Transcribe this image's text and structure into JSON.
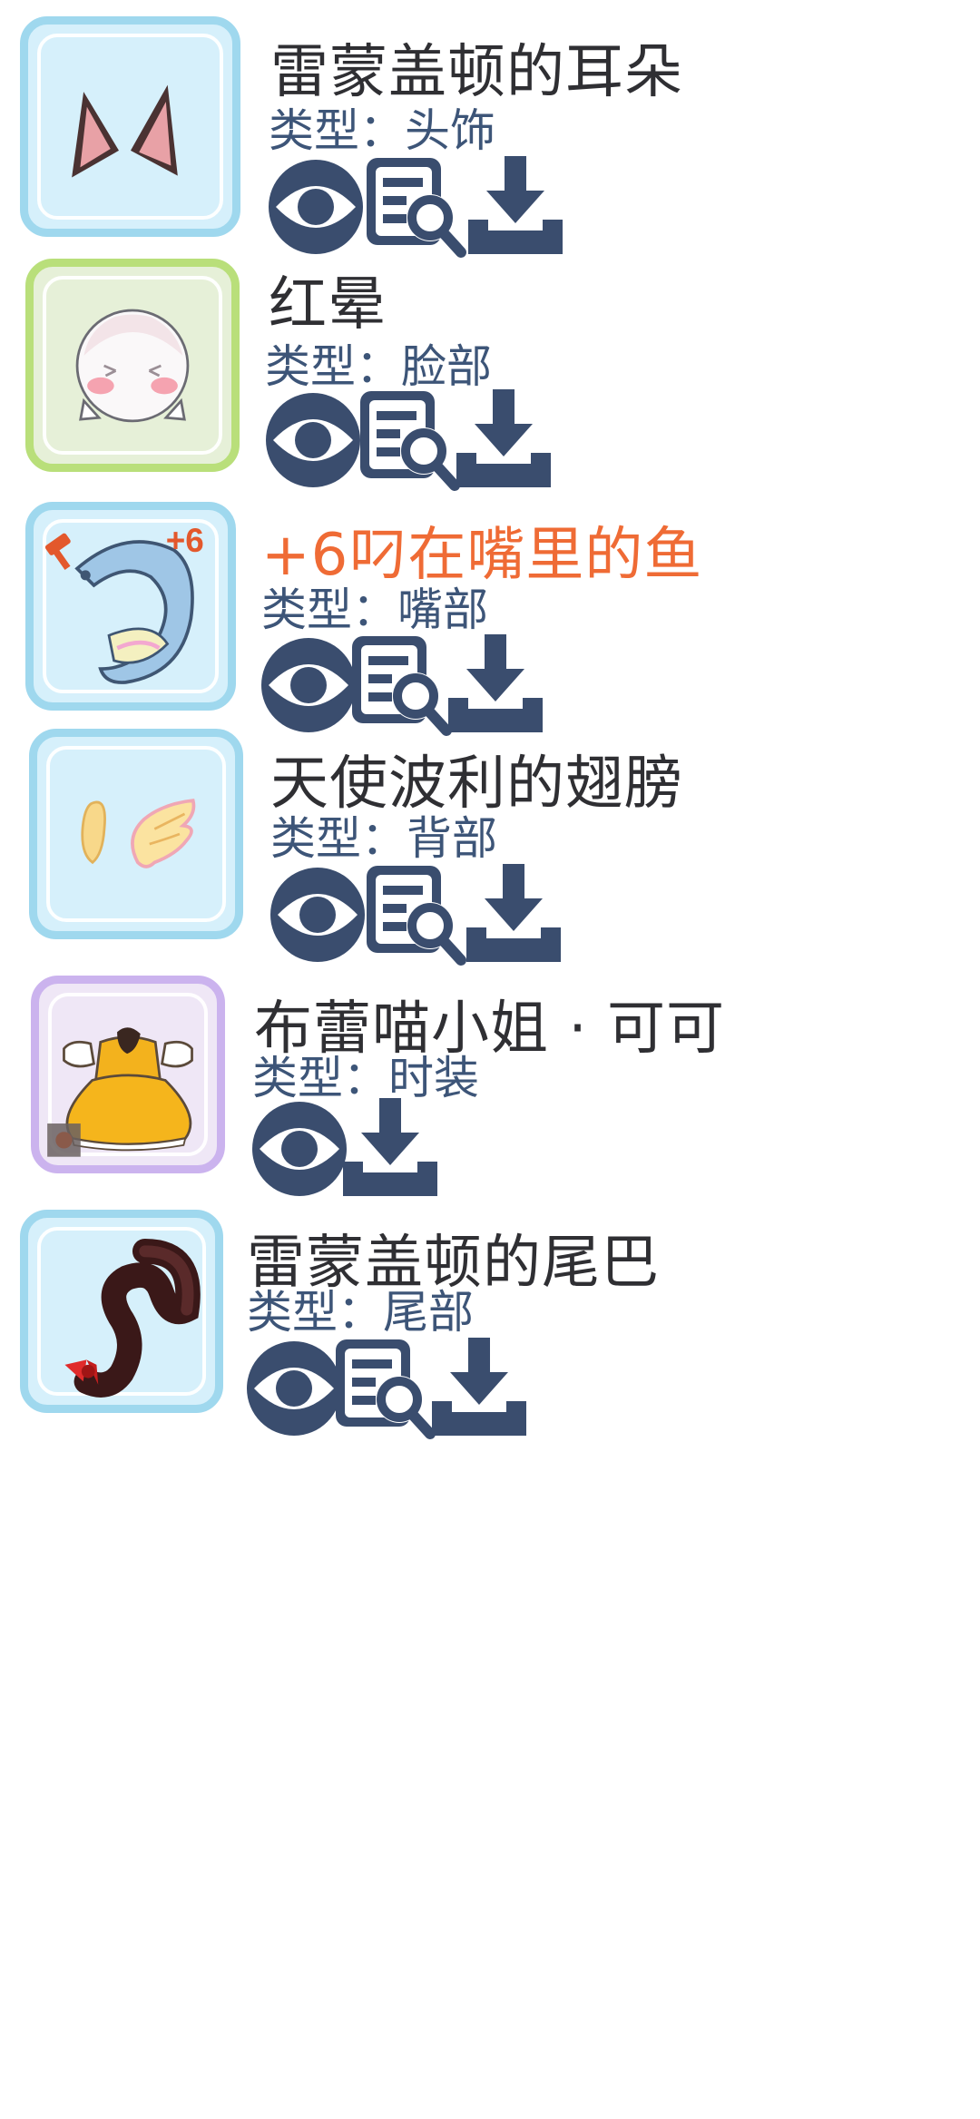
{
  "type_prefix": "类型：",
  "colors": {
    "icon": "#3a4d6e",
    "border_blue": "#9fd8ee",
    "border_green": "#b9df7a",
    "border_purple": "#cbb3ee",
    "title": "#2f2f33",
    "title_upgraded": "#ef6b35",
    "type_text": "#3d5578"
  },
  "icons": {
    "view": "eye-icon",
    "detail": "magnifier-document-icon",
    "download": "download-tray-icon",
    "refine": "hammer-icon"
  },
  "items": [
    {
      "name": "雷蒙盖顿的耳朵",
      "type": "头饰",
      "frame": "blue",
      "preview": "cat-ears"
    },
    {
      "name": "红晕",
      "type": "脸部",
      "frame": "green",
      "preview": "blush-face"
    },
    {
      "name": "+6叼在嘴里的鱼",
      "type": "嘴部",
      "frame": "blue",
      "preview": "fish",
      "refine_level": "+6"
    },
    {
      "name": "天使波利的翅膀",
      "type": "背部",
      "frame": "blue",
      "preview": "angel-wings"
    },
    {
      "name": "布蕾喵小姐 · 可可",
      "type": "时装",
      "frame": "purple",
      "preview": "yellow-dress"
    },
    {
      "name": "雷蒙盖顿的尾巴",
      "type": "尾部",
      "frame": "blue",
      "preview": "dark-tail"
    }
  ]
}
